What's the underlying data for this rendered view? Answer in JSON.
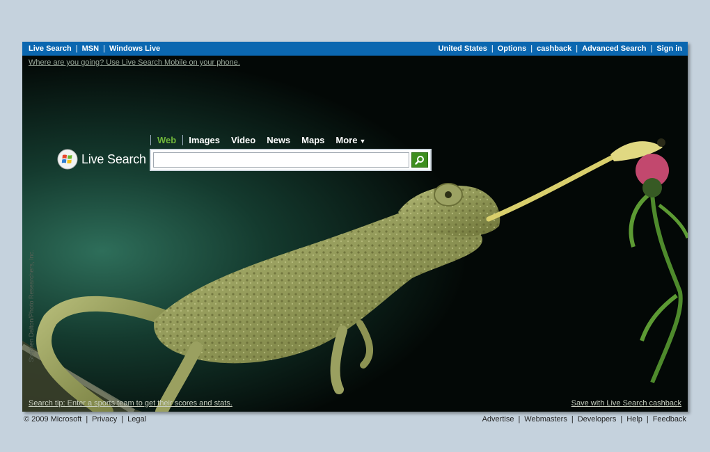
{
  "topbar": {
    "left_links": [
      "Live Search",
      "MSN",
      "Windows Live"
    ],
    "right_links": [
      "United States",
      "Options",
      "cashback",
      "Advanced Search",
      "Sign in"
    ],
    "bg_color": "#0b67b0"
  },
  "promo": {
    "text": "Where are you going? Use Live Search Mobile on your phone."
  },
  "logo": {
    "text": "Live Search",
    "icon": "windows-flag-icon"
  },
  "tabs": [
    {
      "label": "Web",
      "active": true
    },
    {
      "label": "Images"
    },
    {
      "label": "Video"
    },
    {
      "label": "News"
    },
    {
      "label": "Maps"
    },
    {
      "label": "More",
      "caret": "▼"
    }
  ],
  "search": {
    "value": "",
    "placeholder": "",
    "button_icon": "magnifier-icon",
    "button_color": "#3e8e1e"
  },
  "image": {
    "credit": "Stephen Dalton/Photo Researchers, Inc."
  },
  "tip": {
    "text": "Search tip: Enter a sports team to get their scores and stats."
  },
  "cashback_link": {
    "text": "Save with Live Search cashback"
  },
  "footer": {
    "left_links": [
      "© 2009 Microsoft",
      "Privacy",
      "Legal"
    ],
    "right_links": [
      "Advertise",
      "Webmasters",
      "Developers",
      "Help",
      "Feedback"
    ]
  }
}
